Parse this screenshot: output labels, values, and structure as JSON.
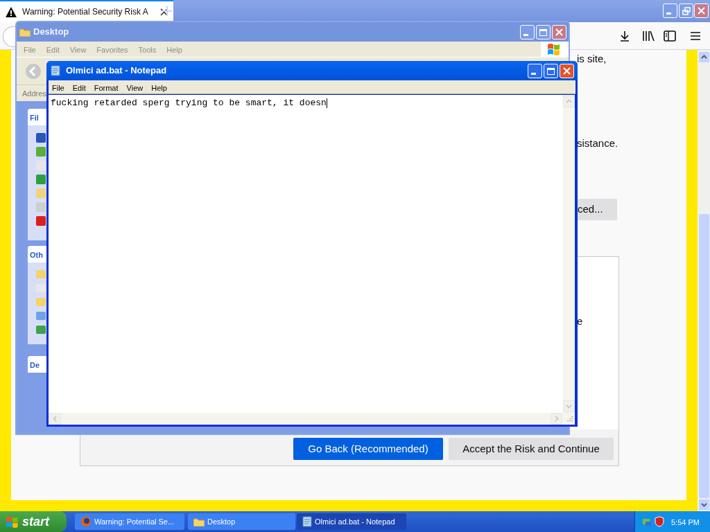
{
  "browser": {
    "tab": {
      "title": "Warning: Potential Security Risk A",
      "selected": true
    },
    "content": {
      "texts": [
        "is site,",
        "sistance."
      ],
      "advanced_button": "ced...",
      "panel_text": "e",
      "buttons": [
        {
          "label": "Go Back (Recommended)",
          "kind": "primary"
        },
        {
          "label": "Accept the Risk and Continue",
          "kind": "secondary"
        }
      ]
    }
  },
  "explorer": {
    "title": "Desktop",
    "active": false,
    "menu": [
      "File",
      "Edit",
      "View",
      "Favorites",
      "Tools",
      "Help"
    ],
    "address_label": "Addres",
    "panels": [
      "Fil",
      "Oth",
      "De"
    ]
  },
  "notepad": {
    "title": "Olmici ad.bat - Notepad",
    "active": true,
    "menu": [
      "File",
      "Edit",
      "Format",
      "View",
      "Help"
    ],
    "text": "fucking retarded sperg trying to be smart, it doesn"
  },
  "taskbar": {
    "start": "start",
    "tasks": [
      {
        "label": "Warning: Potential Se...",
        "kind": "browser",
        "selected": false
      },
      {
        "label": "Desktop",
        "kind": "folder",
        "selected": false
      },
      {
        "label": "Olmici ad.bat - Notepad",
        "kind": "notepad",
        "selected": true
      }
    ],
    "clock": "5:54 PM"
  }
}
